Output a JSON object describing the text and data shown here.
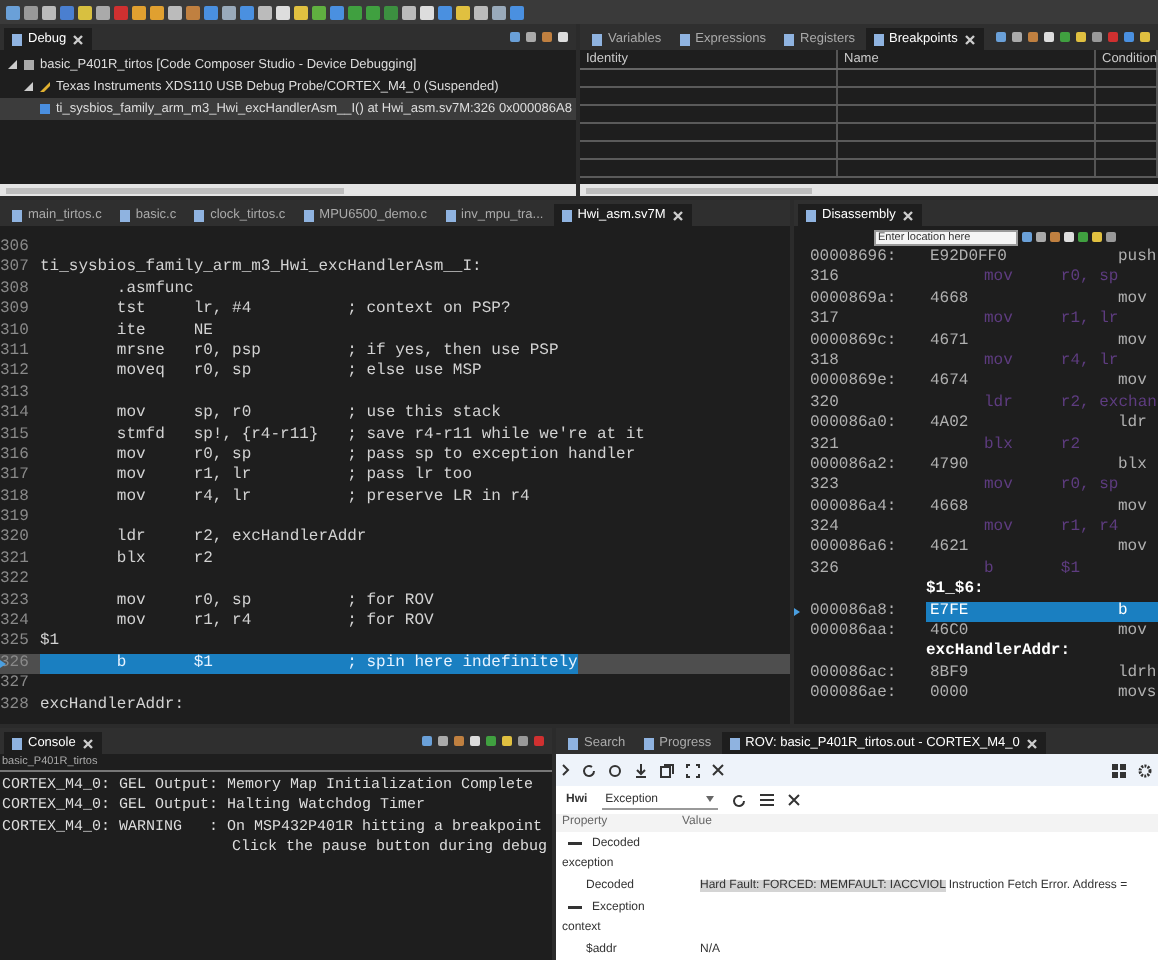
{
  "debug_view": {
    "tab": "Debug",
    "tree": [
      {
        "label": "basic_P401R_tirtos [Code Composer Studio - Device Debugging]",
        "expanded": true,
        "selected": false,
        "children": [
          {
            "label": "Texas Instruments XDS110 USB Debug Probe/CORTEX_M4_0 (Suspended)",
            "expanded": true,
            "selected": false,
            "children": [
              {
                "label": "ti_sysbios_family_arm_m3_Hwi_excHandlerAsm__I() at Hwi_asm.sv7M:326 0x000086A8",
                "selected": true
              }
            ]
          }
        ]
      }
    ]
  },
  "breakpoints_view": {
    "tabs": [
      {
        "label": "Variables",
        "selected": false
      },
      {
        "label": "Expressions",
        "selected": false
      },
      {
        "label": "Registers",
        "selected": false
      },
      {
        "label": "Breakpoints",
        "selected": true
      }
    ],
    "columns": [
      "Identity",
      "Name",
      "Condition"
    ]
  },
  "editor": {
    "tabs": [
      {
        "label": "main_tirtos.c",
        "selected": false
      },
      {
        "label": "basic.c",
        "selected": false
      },
      {
        "label": "clock_tirtos.c",
        "selected": false
      },
      {
        "label": "MPU6500_demo.c",
        "selected": false
      },
      {
        "label": "inv_mpu_tra...",
        "selected": false
      },
      {
        "label": "Hwi_asm.sv7M",
        "selected": true
      }
    ],
    "lines": [
      {
        "num": "306",
        "current": false
      },
      {
        "num": "307",
        "text": "ti_sysbios_family_arm_m3_Hwi_excHandlerAsm__I:",
        "current": false
      },
      {
        "num": "308",
        "text": "        .asmfunc",
        "current": false
      },
      {
        "num": "309",
        "text": "        tst     lr, #4          ; context on PSP?",
        "current": false
      },
      {
        "num": "310",
        "text": "        ite     NE",
        "current": false
      },
      {
        "num": "311",
        "text": "        mrsne   r0, psp         ; if yes, then use PSP",
        "current": false
      },
      {
        "num": "312",
        "text": "        moveq   r0, sp          ; else use MSP",
        "current": false
      },
      {
        "num": "313",
        "current": false
      },
      {
        "num": "314",
        "text": "        mov     sp, r0          ; use this stack",
        "current": false
      },
      {
        "num": "315",
        "text": "        stmfd   sp!, {r4-r11}   ; save r4-r11 while we're at it",
        "current": false
      },
      {
        "num": "316",
        "text": "        mov     r0, sp          ; pass sp to exception handler",
        "current": false
      },
      {
        "num": "317",
        "text": "        mov     r1, lr          ; pass lr too",
        "current": false
      },
      {
        "num": "318",
        "text": "        mov     r4, lr          ; preserve LR in r4",
        "current": false
      },
      {
        "num": "319",
        "current": false
      },
      {
        "num": "320",
        "text": "        ldr     r2, excHandlerAddr",
        "current": false
      },
      {
        "num": "321",
        "text": "        blx     r2",
        "current": false
      },
      {
        "num": "322",
        "current": false
      },
      {
        "num": "323",
        "text": "        mov     r0, sp          ; for ROV",
        "current": false
      },
      {
        "num": "324",
        "text": "        mov     r1, r4          ; for ROV",
        "current": false
      },
      {
        "num": "325",
        "text": "$1",
        "current": false
      },
      {
        "num": "326",
        "text": "        b       $1              ; spin here indefinitely",
        "current": true
      },
      {
        "num": "327",
        "current": false
      },
      {
        "num": "328",
        "text": "excHandlerAddr:",
        "current": false
      }
    ]
  },
  "disassembly": {
    "tab": "Disassembly",
    "location": {
      "placeholder": "Enter location here"
    },
    "rows": [
      {
        "kind": "instr",
        "address": "00008696:",
        "code": "E92D0FF0",
        "mnemonic": "push",
        "selected": false
      },
      {
        "kind": "source",
        "line": "316",
        "text": "mov     r0, sp"
      },
      {
        "kind": "instr",
        "address": "0000869a:",
        "code": "4668",
        "mnemonic": "mov",
        "selected": false
      },
      {
        "kind": "source",
        "line": "317",
        "text": "mov     r1, lr"
      },
      {
        "kind": "instr",
        "address": "0000869c:",
        "code": "4671",
        "mnemonic": "mov",
        "selected": false
      },
      {
        "kind": "source",
        "line": "318",
        "text": "mov     r4, lr"
      },
      {
        "kind": "instr",
        "address": "0000869e:",
        "code": "4674",
        "mnemonic": "mov",
        "selected": false
      },
      {
        "kind": "source",
        "line": "320",
        "text": "ldr     r2, exchan"
      },
      {
        "kind": "instr",
        "address": "000086a0:",
        "code": "4A02",
        "mnemonic": "ldr",
        "selected": false
      },
      {
        "kind": "source",
        "line": "321",
        "text": "blx     r2"
      },
      {
        "kind": "instr",
        "address": "000086a2:",
        "code": "4790",
        "mnemonic": "blx",
        "selected": false
      },
      {
        "kind": "source",
        "line": "323",
        "text": "mov     r0, sp"
      },
      {
        "kind": "instr",
        "address": "000086a4:",
        "code": "4668",
        "mnemonic": "mov",
        "selected": false
      },
      {
        "kind": "source",
        "line": "324",
        "text": "mov     r1, r4"
      },
      {
        "kind": "instr",
        "address": "000086a6:",
        "code": "4621",
        "mnemonic": "mov",
        "selected": false
      },
      {
        "kind": "source",
        "line": "326",
        "text": "b       $1"
      },
      {
        "kind": "label",
        "text": "$1_$6:"
      },
      {
        "kind": "instr",
        "address": "000086a8:",
        "code": "E7FE",
        "mnemonic": "b",
        "selected": true
      },
      {
        "kind": "instr",
        "address": "000086aa:",
        "code": "46C0",
        "mnemonic": "mov",
        "selected": false
      },
      {
        "kind": "label",
        "text": "excHandlerAddr:"
      },
      {
        "kind": "instr",
        "address": "000086ac:",
        "code": "8BF9",
        "mnemonic": "ldrh",
        "selected": false
      },
      {
        "kind": "instr",
        "address": "000086ae:",
        "code": "0000",
        "mnemonic": "movs",
        "selected": false
      }
    ]
  },
  "console": {
    "tab": "Console",
    "subtitle": "basic_P401R_tirtos",
    "lines": [
      {
        "kind": "message",
        "text": "CORTEX_M4_0: GEL Output: Memory Map Initialization Complete"
      },
      {
        "kind": "message",
        "text": "CORTEX_M4_0: GEL Output: Halting Watchdog Timer"
      },
      {
        "kind": "message",
        "text": "CORTEX_M4_0: WARNING   : On MSP432P401R hitting a breakpoint"
      },
      {
        "kind": "continuation",
        "text": "Click the pause button during debug"
      }
    ]
  },
  "rov": {
    "tabs": [
      {
        "label": "Search",
        "selected": false
      },
      {
        "label": "Progress",
        "selected": false
      },
      {
        "label": "ROV: basic_P401R_tirtos.out - CORTEX_M4_0",
        "selected": true
      }
    ],
    "module": "Hwi",
    "view": "Exception",
    "columns": [
      "Property",
      "Value"
    ],
    "rows": [
      {
        "kind": "group",
        "label": "Decoded"
      },
      {
        "kind": "section",
        "label": "exception"
      },
      {
        "kind": "prop",
        "name": "Decoded",
        "highlight": "Hard Fault: FORCED: MEMFAULT: IACCVIOL",
        "value": "Instruction Fetch Error. Address ="
      },
      {
        "kind": "group",
        "label": "Exception"
      },
      {
        "kind": "section",
        "label": "context"
      },
      {
        "kind": "prop",
        "name": "$addr",
        "value": "N/A"
      }
    ]
  }
}
